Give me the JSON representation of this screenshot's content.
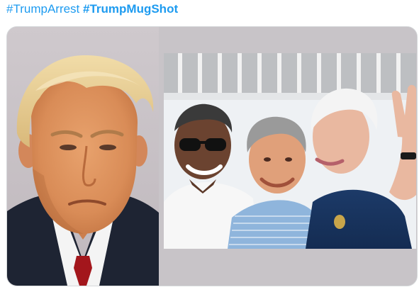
{
  "tweet": {
    "hashtags": [
      {
        "text": "#TrumpArrest",
        "bold": false
      },
      {
        "text": "#TrumpMugShot",
        "bold": true
      }
    ]
  },
  "media": {
    "images": [
      {
        "subject": "mugshot-photo"
      },
      {
        "subject": "group-photo"
      }
    ]
  },
  "colors": {
    "link": "#1d9bf0",
    "card_border": "#d6d9db",
    "card_background": "#c9c5c9"
  }
}
